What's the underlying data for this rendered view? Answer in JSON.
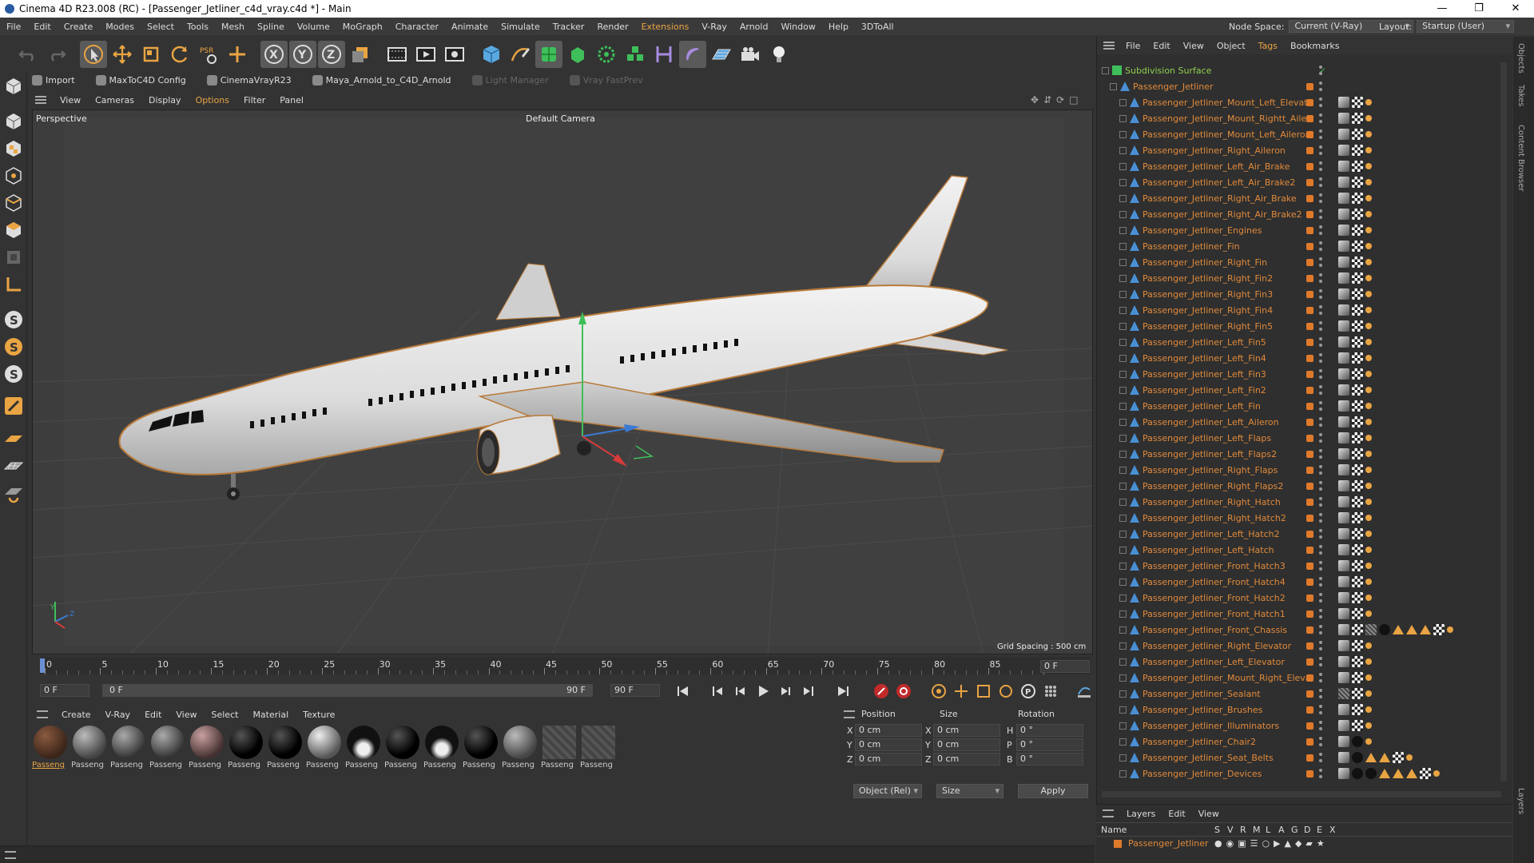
{
  "window": {
    "title": "Cinema 4D R23.008 (RC) - [Passenger_Jetliner_c4d_vray.c4d *] - Main",
    "minimize": "—",
    "maximize": "❐",
    "close": "✕"
  },
  "menubar": {
    "items": [
      "File",
      "Edit",
      "Create",
      "Modes",
      "Select",
      "Tools",
      "Mesh",
      "Spline",
      "Volume",
      "MoGraph",
      "Character",
      "Animate",
      "Simulate",
      "Tracker",
      "Render",
      "Extensions",
      "V-Ray",
      "Arnold",
      "Window",
      "Help",
      "3DToAll"
    ],
    "node_space_label": "Node Space:",
    "node_space_value": "Current (V-Ray)",
    "layout_label": "Layout:",
    "layout_value": "Startup (User)"
  },
  "plugins": [
    {
      "label": "Import",
      "enabled": true
    },
    {
      "label": "MaxToC4D Config",
      "enabled": true
    },
    {
      "label": "CinemaVrayR23",
      "enabled": true
    },
    {
      "label": "Maya_Arnold_to_C4D_Arnold",
      "enabled": true
    },
    {
      "label": "Light Manager",
      "enabled": false
    },
    {
      "label": "Vray FastPrev",
      "enabled": false
    }
  ],
  "viewport": {
    "menu": [
      "View",
      "Cameras",
      "Display",
      "Options",
      "Filter",
      "Panel"
    ],
    "active_menu": "Options",
    "projection": "Perspective",
    "camera": "Default Camera",
    "grid_spacing": "Grid Spacing : 500 cm",
    "axis_y": "Y",
    "axis_z": "Z"
  },
  "timeline": {
    "ticks": [
      "0",
      "5",
      "10",
      "15",
      "20",
      "25",
      "30",
      "35",
      "40",
      "45",
      "50",
      "55",
      "60",
      "65",
      "70",
      "75",
      "80",
      "85",
      "90"
    ],
    "current_frame": "0 F",
    "start": "0 F",
    "range_start": "0 F",
    "range_end": "90 F",
    "end": "90 F",
    "frame_display": "0 F"
  },
  "materials": {
    "menu": [
      "Create",
      "V-Ray",
      "Edit",
      "View",
      "Select",
      "Material",
      "Texture"
    ],
    "items": [
      {
        "label": "Passeng",
        "style": "brown",
        "selected": true
      },
      {
        "label": "Passeng",
        "style": "grey"
      },
      {
        "label": "Passeng",
        "style": "greytex"
      },
      {
        "label": "Passeng",
        "style": "greytex"
      },
      {
        "label": "Passeng",
        "style": "pinktex"
      },
      {
        "label": "Passeng",
        "style": "black"
      },
      {
        "label": "Passeng",
        "style": "black"
      },
      {
        "label": "Passeng",
        "style": "whiteblack"
      },
      {
        "label": "Passeng",
        "style": "blackwhite"
      },
      {
        "label": "Passeng",
        "style": "black"
      },
      {
        "label": "Passeng",
        "style": "blackwhite"
      },
      {
        "label": "Passeng",
        "style": "black"
      },
      {
        "label": "Passeng",
        "style": "grey"
      },
      {
        "label": "Passeng",
        "style": "hatch"
      },
      {
        "label": "Passeng",
        "style": "hatch"
      }
    ]
  },
  "attributes": {
    "headers": [
      "Position",
      "Size",
      "Rotation"
    ],
    "rows": [
      {
        "ax1": "X",
        "pos": "0 cm",
        "ax2": "X",
        "size": "0 cm",
        "ax3": "H",
        "rot": "0 °"
      },
      {
        "ax1": "Y",
        "pos": "0 cm",
        "ax2": "Y",
        "size": "0 cm",
        "ax3": "P",
        "rot": "0 °"
      },
      {
        "ax1": "Z",
        "pos": "0 cm",
        "ax2": "Z",
        "size": "0 cm",
        "ax3": "B",
        "rot": "0 °"
      }
    ],
    "coord_mode": "Object (Rel)",
    "size_mode": "Size",
    "apply": "Apply"
  },
  "objects": {
    "menu": [
      "File",
      "Edit",
      "View",
      "Object",
      "Tags",
      "Bookmarks"
    ],
    "active_menu": "Tags",
    "root": "Subdivision Surface",
    "group": "Passenger_Jetliner",
    "items": [
      {
        "name": "Passenger_Jetliner_Mount_Left_Elevator",
        "tags": "basic"
      },
      {
        "name": "Passenger_Jetliner_Mount_Rightt_Aileron",
        "tags": "basic"
      },
      {
        "name": "Passenger_Jetliner_Mount_Left_Aileron",
        "tags": "basic"
      },
      {
        "name": "Passenger_Jetliner_Right_Aileron",
        "tags": "basic"
      },
      {
        "name": "Passenger_Jetliner_Left_Air_Brake",
        "tags": "basic"
      },
      {
        "name": "Passenger_Jetliner_Left_Air_Brake2",
        "tags": "basic"
      },
      {
        "name": "Passenger_Jetliner_Right_Air_Brake",
        "tags": "basic"
      },
      {
        "name": "Passenger_Jetliner_Right_Air_Brake2",
        "tags": "basic"
      },
      {
        "name": "Passenger_Jetliner_Engines",
        "tags": "basic"
      },
      {
        "name": "Passenger_Jetliner_Fin",
        "tags": "basic"
      },
      {
        "name": "Passenger_Jetliner_Right_Fin",
        "tags": "basic"
      },
      {
        "name": "Passenger_Jetliner_Right_Fin2",
        "tags": "basic"
      },
      {
        "name": "Passenger_Jetliner_Right_Fin3",
        "tags": "basic"
      },
      {
        "name": "Passenger_Jetliner_Right_Fin4",
        "tags": "basic"
      },
      {
        "name": "Passenger_Jetliner_Right_Fin5",
        "tags": "basic"
      },
      {
        "name": "Passenger_Jetliner_Left_Fin5",
        "tags": "basic"
      },
      {
        "name": "Passenger_Jetliner_Left_Fin4",
        "tags": "basic"
      },
      {
        "name": "Passenger_Jetliner_Left_Fin3",
        "tags": "basic"
      },
      {
        "name": "Passenger_Jetliner_Left_Fin2",
        "tags": "basic"
      },
      {
        "name": "Passenger_Jetliner_Left_Fin",
        "tags": "basic"
      },
      {
        "name": "Passenger_Jetliner_Left_Aileron",
        "tags": "basic"
      },
      {
        "name": "Passenger_Jetliner_Left_Flaps",
        "tags": "basic"
      },
      {
        "name": "Passenger_Jetliner_Left_Flaps2",
        "tags": "basic"
      },
      {
        "name": "Passenger_Jetliner_Right_Flaps",
        "tags": "basic"
      },
      {
        "name": "Passenger_Jetliner_Right_Flaps2",
        "tags": "basic"
      },
      {
        "name": "Passenger_Jetliner_Right_Hatch",
        "tags": "basic"
      },
      {
        "name": "Passenger_Jetliner_Right_Hatch2",
        "tags": "basic"
      },
      {
        "name": "Passenger_Jetliner_Left_Hatch2",
        "tags": "basic"
      },
      {
        "name": "Passenger_Jetliner_Left_Hatch",
        "tags": "basic"
      },
      {
        "name": "Passenger_Jetliner_Front_Hatch3",
        "tags": "basic"
      },
      {
        "name": "Passenger_Jetliner_Front_Hatch4",
        "tags": "basic"
      },
      {
        "name": "Passenger_Jetliner_Front_Hatch2",
        "tags": "basic"
      },
      {
        "name": "Passenger_Jetliner_Front_Hatch1",
        "tags": "basic"
      },
      {
        "name": "Passenger_Jetliner_Front_Chassis",
        "tags": "chassis"
      },
      {
        "name": "Passenger_Jetliner_Right_Elevator",
        "tags": "basic"
      },
      {
        "name": "Passenger_Jetliner_Left_Elevator",
        "tags": "basic"
      },
      {
        "name": "Passenger_Jetliner_Mount_Right_Elevator",
        "tags": "basic"
      },
      {
        "name": "Passenger_Jetliner_Sealant",
        "tags": "hatch"
      },
      {
        "name": "Passenger_Jetliner_Brushes",
        "tags": "basic"
      },
      {
        "name": "Passenger_Jetliner_Illuminators",
        "tags": "basic"
      },
      {
        "name": "Passenger_Jetliner_Chair2",
        "tags": "dark"
      },
      {
        "name": "Passenger_Jetliner_Seat_Belts",
        "tags": "belts"
      },
      {
        "name": "Passenger_Jetliner_Devices",
        "tags": "devices"
      }
    ]
  },
  "layers": {
    "menu": [
      "Layers",
      "Edit",
      "View"
    ],
    "name_header": "Name",
    "cols": [
      "S",
      "V",
      "R",
      "M",
      "L",
      "A",
      "G",
      "D",
      "E",
      "X"
    ],
    "layer_name": "Passenger_Jetliner"
  },
  "sidetabs": [
    "Objects",
    "Takes",
    "Content Browser",
    "Layers"
  ],
  "colors": {
    "accent": "#e9a443",
    "object_name": "#e08a3b",
    "root_name": "#8fd14f"
  }
}
